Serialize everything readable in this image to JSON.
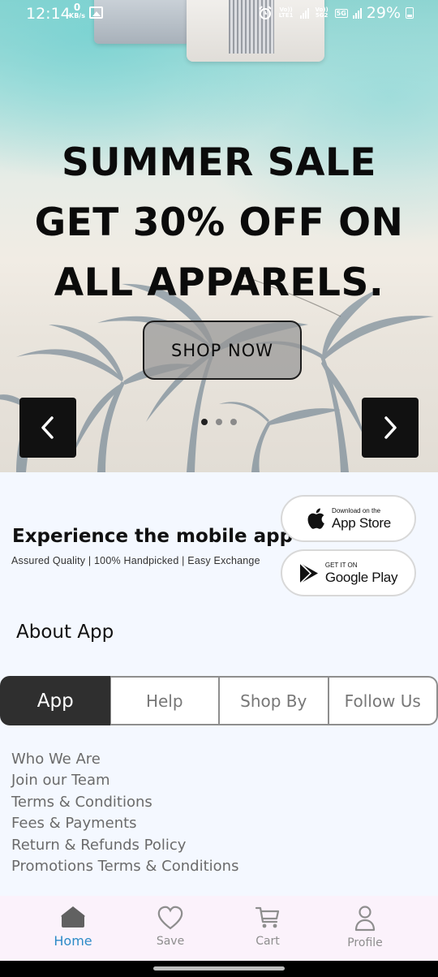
{
  "status_bar": {
    "time": "12:14",
    "net_speed_value": "0",
    "net_speed_unit": "KB/s",
    "sim1_label": "Vo)) LTE1",
    "sim2_label": "Vo)) 5G2",
    "network_badge": "5G",
    "battery": "29%"
  },
  "hero": {
    "title": "SUMMER SALE GET 30% OFF ON ALL APPARELS.",
    "cta_label": "SHOP NOW",
    "slide_count": 3,
    "active_slide": 1
  },
  "app_promo": {
    "title": "Experience the mobile app",
    "subtitle": "Assured Quality | 100% Handpicked | Easy Exchange",
    "app_store": {
      "small": "Download on the",
      "big": "App Store"
    },
    "google_play": {
      "small": "GET IT ON",
      "big": "Google Play"
    }
  },
  "about": {
    "title": "About App",
    "tabs": [
      {
        "label": "App",
        "active": true
      },
      {
        "label": "Help",
        "active": false
      },
      {
        "label": "Shop By",
        "active": false
      },
      {
        "label": "Follow Us",
        "active": false
      }
    ],
    "links": [
      "Who We Are",
      "Join our Team",
      "Terms & Conditions",
      "Fees & Payments",
      "Return & Refunds Policy",
      "Promotions Terms & Conditions"
    ]
  },
  "bottom_nav": [
    {
      "label": "Home",
      "icon": "home-icon",
      "active": true
    },
    {
      "label": "Save",
      "icon": "heart-icon",
      "active": false
    },
    {
      "label": "Cart",
      "icon": "cart-icon",
      "active": false
    },
    {
      "label": "Profile",
      "icon": "profile-icon",
      "active": false
    }
  ],
  "colors": {
    "accent": "#2d8bc7",
    "active_tab_bg": "#2f2f2f",
    "bottom_nav_bg": "#fbf2fb",
    "page_bg": "#f4f8ff"
  }
}
